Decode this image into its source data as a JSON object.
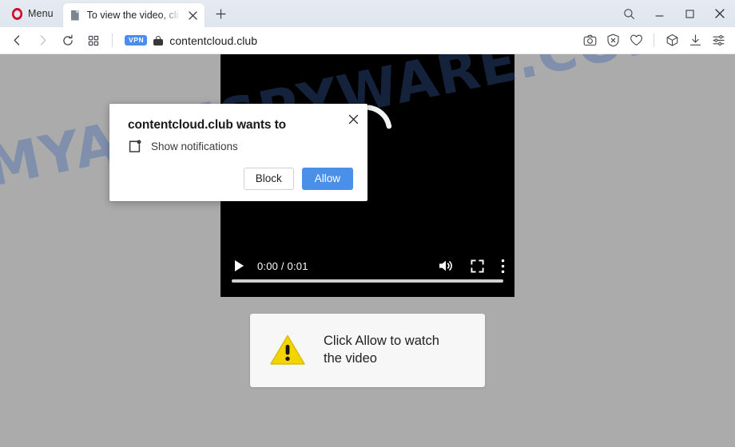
{
  "browser": {
    "menu_label": "Menu",
    "tab": {
      "title": "To view the video, cli",
      "favicon_icon": "document-icon",
      "close_icon": "close-icon"
    },
    "new_tab_icon": "plus-icon",
    "window_controls": [
      {
        "name": "search-icon",
        "label": "Search"
      },
      {
        "name": "minimize-icon",
        "label": "Minimize"
      },
      {
        "name": "maximize-icon",
        "label": "Maximize"
      },
      {
        "name": "close-window-icon",
        "label": "Close"
      }
    ],
    "nav": {
      "back_icon": "back-arrow-icon",
      "forward_icon": "forward-arrow-icon",
      "reload_icon": "reload-icon",
      "speeddial_icon": "grid-icon"
    },
    "address": {
      "vpn_badge": "VPN",
      "lock_icon": "lock-icon",
      "url": "contentcloud.club"
    },
    "toolbar_right": [
      {
        "name": "snapshot-icon",
        "label": "Snapshot"
      },
      {
        "name": "ad-blocker-icon",
        "label": "Ad blocker"
      },
      {
        "name": "heart-icon",
        "label": "Save to"
      },
      {
        "name": "extensions-icon",
        "label": "Extensions"
      },
      {
        "name": "downloads-icon",
        "label": "Downloads"
      },
      {
        "name": "easy-setup-icon",
        "label": "Easy setup"
      }
    ]
  },
  "permission_dialog": {
    "title": "contentcloud.club wants to",
    "permission_icon": "notification-icon",
    "permission_label": "Show notifications",
    "block_label": "Block",
    "allow_label": "Allow",
    "close_icon": "close-icon",
    "accent_color": "#4a90e8"
  },
  "page": {
    "watermark": "MYANTISPYWARE.COM",
    "watermark_color_light": "#4669af",
    "watermark_color_dark": "#345496",
    "background_color": "#ababab",
    "video": {
      "play_icon": "play-icon",
      "time_display": "0:00 / 0:01",
      "current_time": "0:00",
      "duration": "0:01",
      "progress_percent": 0,
      "mute_icon": "volume-icon",
      "fullscreen_icon": "fullscreen-icon",
      "more_icon": "more-vertical-icon",
      "is_loading": true
    },
    "notice": {
      "icon": "warning-triangle-icon",
      "text": "Click Allow to watch\nthe video",
      "icon_color": "#f2d000",
      "background_color": "#f7f7f7"
    }
  }
}
